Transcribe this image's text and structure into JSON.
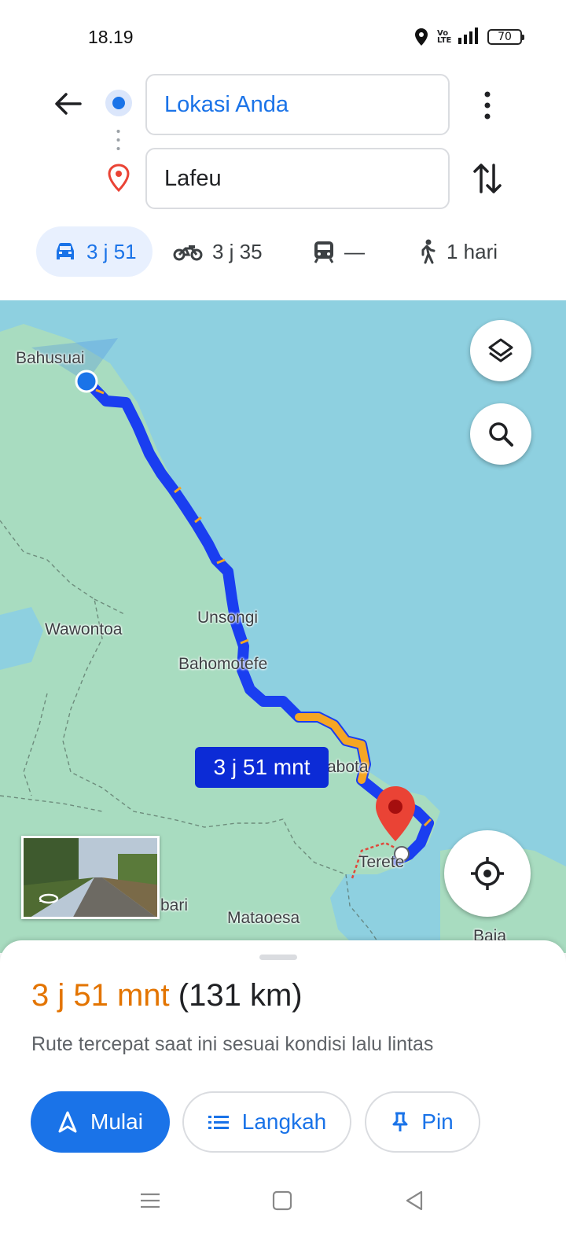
{
  "status_bar": {
    "time": "18.19",
    "network": "4G",
    "volte": "Vo LTE",
    "battery": "70"
  },
  "route": {
    "origin": "Lokasi Anda",
    "destination": "Lafeu"
  },
  "travel_modes": [
    {
      "mode": "car-icon",
      "label": "3 j 51",
      "active": true
    },
    {
      "mode": "motorcycle-icon",
      "label": "3 j 35",
      "active": false
    },
    {
      "mode": "transit-icon",
      "label": "—",
      "active": false
    },
    {
      "mode": "walk-icon",
      "label": "1 hari",
      "active": false
    }
  ],
  "map": {
    "labels": {
      "bahusuai": "Bahusuai",
      "wawontoa": "Wawontoa",
      "unsongi": "Unsongi",
      "bahomotefe": "Bahomotefe",
      "abota": "abota",
      "terete": "Terete",
      "bari": "bari",
      "mataoesa": "Mataoesa",
      "baja": "Baja"
    },
    "route_badge": "3 j 51 mnt",
    "colors": {
      "water": "#8ed0e0",
      "land": "#a8dcc0",
      "route": "#1a3ef0",
      "traffic": "#f5a623",
      "pin": "#ea4335"
    }
  },
  "sheet": {
    "duration": "3 j 51 mnt",
    "distance": "(131 km)",
    "subtitle": "Rute tercepat saat ini sesuai kondisi lalu lintas",
    "buttons": {
      "start": "Mulai",
      "steps": "Langkah",
      "pin": "Pin"
    }
  }
}
